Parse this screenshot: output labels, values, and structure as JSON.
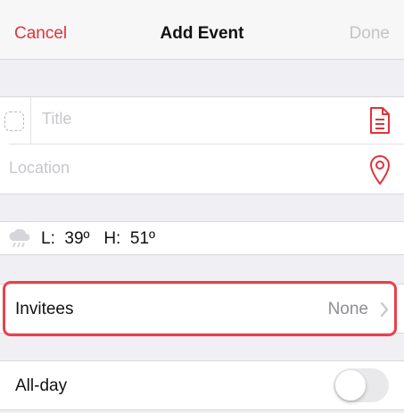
{
  "navbar": {
    "cancel_label": "Cancel",
    "title": "Add Event",
    "done_label": "Done"
  },
  "event_form": {
    "title_placeholder": "Title",
    "location_placeholder": "Location",
    "notes_icon": "notes-icon",
    "location_icon": "location-pin-icon"
  },
  "weather": {
    "icon": "rain-cloud-icon",
    "text": "L:  39º   H:  51º"
  },
  "invitees": {
    "label": "Invitees",
    "value": "None"
  },
  "all_day": {
    "label": "All-day",
    "enabled": false
  },
  "colors": {
    "accent": "#e0333a",
    "highlight": "#e8414b",
    "disabled_text": "#c4c4c8",
    "secondary_text": "#8e8e93"
  }
}
